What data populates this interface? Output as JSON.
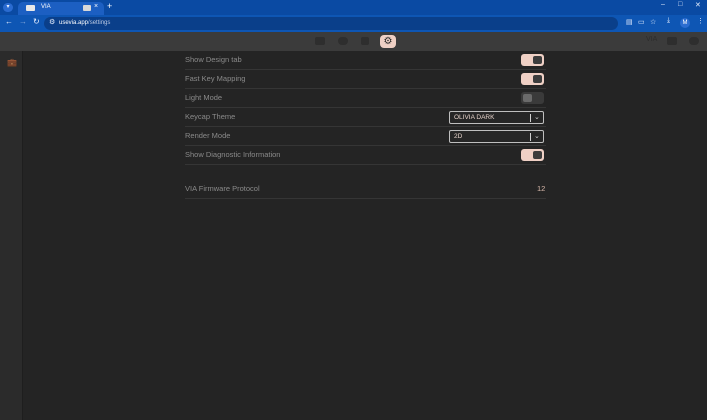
{
  "browser": {
    "tab": {
      "title": "VIA"
    },
    "omnibox": {
      "host": "usevia.app",
      "path": "/settings"
    },
    "profile_initial": "M",
    "icons": [
      "tab-list-icon",
      "back-icon",
      "forward-icon",
      "reload-icon",
      "site-info-icon",
      "translate-icon",
      "cast-icon",
      "bookmark-star-icon",
      "download-icon",
      "menu-kebab-icon",
      "minimize-icon",
      "maximize-icon",
      "close-window-icon"
    ]
  },
  "app": {
    "header": {
      "active_tab": "settings",
      "tabs": [
        "configure-keyboard-icon",
        "key-tester-icon",
        "design-icon",
        "settings-gear-icon"
      ],
      "right_links": [
        "VIA",
        "discord-icon",
        "github-icon"
      ]
    },
    "rail": {
      "icon": "briefcase-icon"
    },
    "settings": {
      "show_design_tab": {
        "label": "Show Design tab",
        "enabled": true
      },
      "fast_key_mapping": {
        "label": "Fast Key Mapping",
        "enabled": true
      },
      "light_mode": {
        "label": "Light Mode",
        "enabled": false
      },
      "keycap_theme": {
        "label": "Keycap Theme",
        "value": "OLIVIA DARK"
      },
      "render_mode": {
        "label": "Render Mode",
        "value": "2D"
      },
      "show_diagnostic": {
        "label": "Show Diagnostic Information",
        "enabled": true
      },
      "firmware_protocol": {
        "label": "VIA Firmware Protocol",
        "value": "12"
      }
    }
  },
  "colors": {
    "accent": "#efd0c5",
    "background": "#242424",
    "header": "#3b3b3b",
    "browser_chrome": "#0e56b4"
  }
}
